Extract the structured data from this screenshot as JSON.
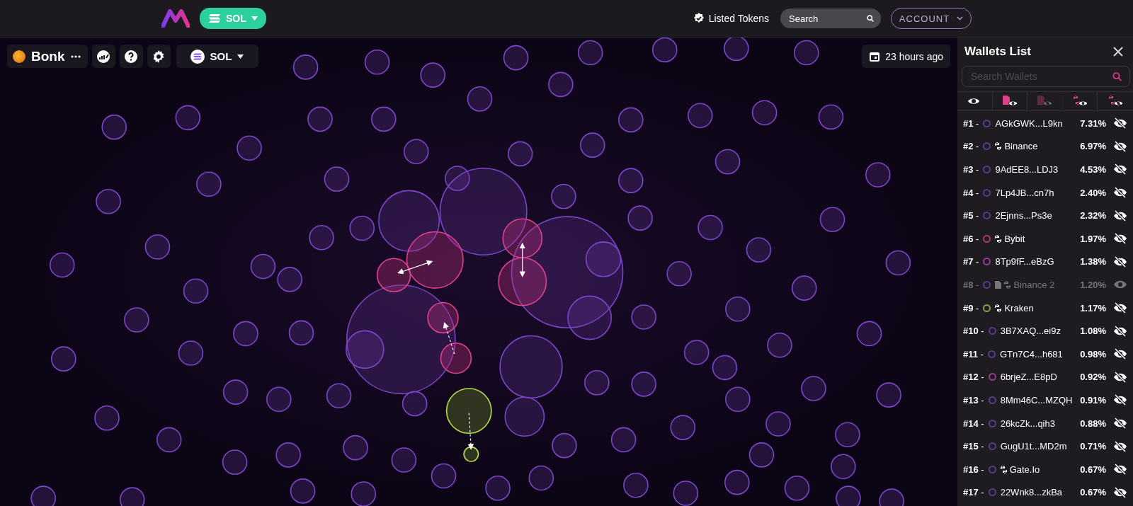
{
  "topbar": {
    "chain": "SOL",
    "listed_tokens": "Listed Tokens",
    "search": {
      "placeholder": "Search"
    },
    "account": "ACCOUNT"
  },
  "toolbar": {
    "token": "Bonk",
    "chain": "SOL",
    "updated": "23 hours ago"
  },
  "wallets_panel": {
    "title": "Wallets List",
    "search": {
      "placeholder": "Search Wallets"
    },
    "filters": [
      {
        "kind": "all",
        "on": true
      },
      {
        "kind": "contract-show",
        "on": true
      },
      {
        "kind": "contract-hide",
        "on": false
      },
      {
        "kind": "exchange-show",
        "on": true
      },
      {
        "kind": "exchange-hide",
        "on": true
      }
    ],
    "wallets": [
      {
        "rank": "**#1** -",
        "color": "#5b3a8c",
        "contract": false,
        "exchange": false,
        "name": "AGkGWK...L9kn",
        "share": "7.31%",
        "hidden": false
      },
      {
        "rank": "**#2** -",
        "color": "#5b3a8c",
        "contract": false,
        "exchange": true,
        "name": "Binance",
        "share": "6.97%",
        "hidden": false
      },
      {
        "rank": "**#3** -",
        "color": "#5b3a8c",
        "contract": false,
        "exchange": false,
        "name": "9AdEE8...LDJ3",
        "share": "4.53%",
        "hidden": false
      },
      {
        "rank": "**#4** -",
        "color": "#5b3a8c",
        "contract": false,
        "exchange": false,
        "name": "7Lp4JB...cn7h",
        "share": "2.40%",
        "hidden": false
      },
      {
        "rank": "**#5** -",
        "color": "#5b3a8c",
        "contract": false,
        "exchange": false,
        "name": "2Ejnns...Ps3e",
        "share": "2.32%",
        "hidden": false
      },
      {
        "rank": "**#6** -",
        "color": "#a8385f",
        "contract": false,
        "exchange": true,
        "name": "Bybit",
        "share": "1.97%",
        "hidden": false
      },
      {
        "rank": "**#7** -",
        "color": "#9b3a8f",
        "contract": false,
        "exchange": false,
        "name": "8Tp9fF...eBzG",
        "share": "1.38%",
        "hidden": false
      },
      {
        "rank": "**#8** -",
        "color": "#5b3a8c",
        "contract": true,
        "exchange": true,
        "name": "Binance 2",
        "share": "1.20%",
        "hidden": true
      },
      {
        "rank": "**#9** -",
        "color": "#7fa34a",
        "contract": false,
        "exchange": true,
        "name": "Kraken",
        "share": "1.17%",
        "hidden": false
      },
      {
        "rank": "**#10** -",
        "color": "#5b3a8c",
        "contract": false,
        "exchange": false,
        "name": "3B7XAQ...ei9z",
        "share": "1.08%",
        "hidden": false
      },
      {
        "rank": "**#11** -",
        "color": "#5b3a8c",
        "contract": false,
        "exchange": false,
        "name": "GTn7C4...h681",
        "share": "0.98%",
        "hidden": false
      },
      {
        "rank": "**#12** -",
        "color": "#9b3a8f",
        "contract": false,
        "exchange": false,
        "name": "6brjeZ...E8pD",
        "share": "0.92%",
        "hidden": false
      },
      {
        "rank": "**#13** -",
        "color": "#5b3a8c",
        "contract": false,
        "exchange": false,
        "name": "8Mm46C...MZQH",
        "share": "0.91%",
        "hidden": false
      },
      {
        "rank": "**#14** -",
        "color": "#5b3a8c",
        "contract": false,
        "exchange": false,
        "name": "26kcZk...qih3",
        "share": "0.88%",
        "hidden": false
      },
      {
        "rank": "**#15** -",
        "color": "#5b3a8c",
        "contract": false,
        "exchange": false,
        "name": "GugU1t...MD2m",
        "share": "0.71%",
        "hidden": false
      },
      {
        "rank": "**#16** -",
        "color": "#5b3a8c",
        "contract": false,
        "exchange": true,
        "name": "Gate.Io",
        "share": "0.67%",
        "hidden": false
      },
      {
        "rank": "**#17** -",
        "color": "#5b3a8c",
        "contract": false,
        "exchange": false,
        "name": "22Wnk8...zkBa",
        "share": "0.67%",
        "hidden": false
      }
    ]
  }
}
